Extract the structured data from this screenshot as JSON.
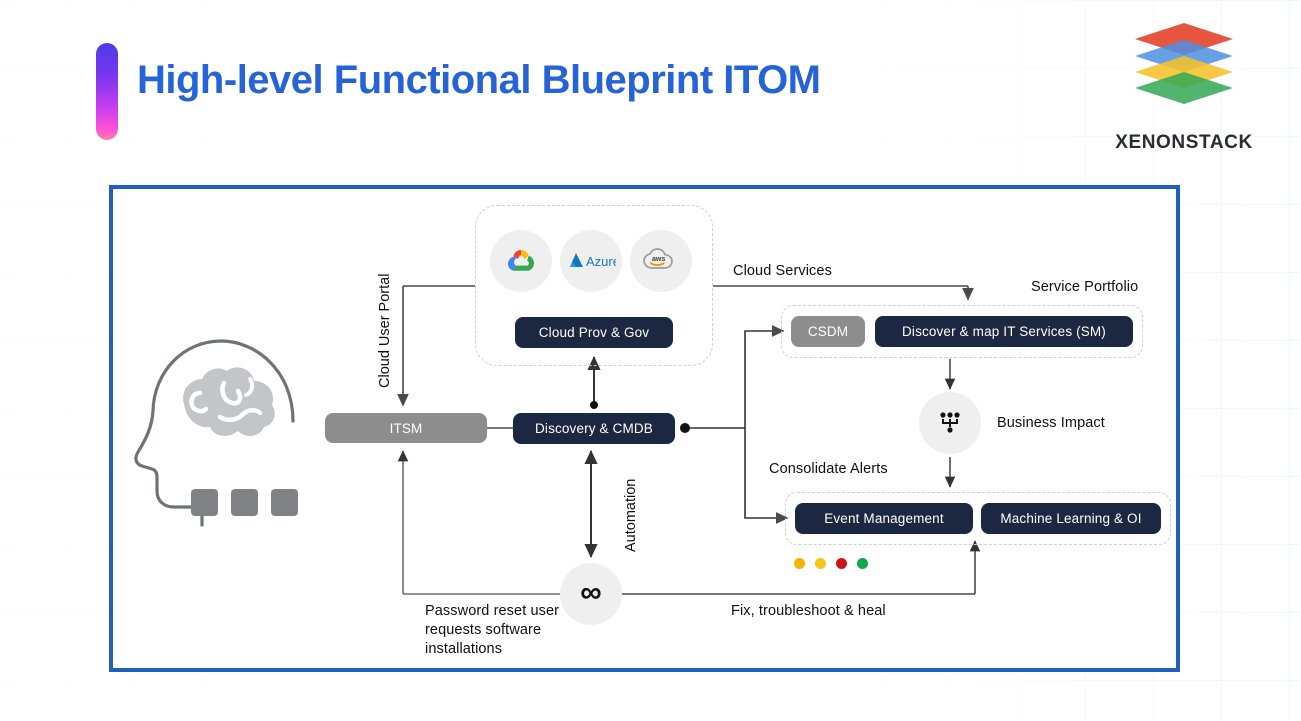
{
  "header": {
    "title": "High-level Functional Blueprint ITOM",
    "title_color": "#2563d6",
    "accent_bar": "gradient-violet-pink"
  },
  "brand": {
    "name": "XENONSTACK",
    "logo_name": "xenonstack-logo",
    "layer_colors": [
      "#e5482f",
      "#4a90e2",
      "#f6c12a",
      "#34a853"
    ]
  },
  "canvas": {
    "border_color": "#1f5fbe"
  },
  "persona": {
    "icon_name": "head-brain-icon",
    "blocks": 3
  },
  "cloud_group": {
    "providers": [
      {
        "name": "google-cloud-icon",
        "label": ""
      },
      {
        "name": "microsoft-azure-icon",
        "label": "Azure"
      },
      {
        "name": "aws-icon",
        "label": "aws"
      }
    ],
    "node_label": "Cloud Prov & Gov"
  },
  "nodes": {
    "itsm": "ITSM",
    "discovery_cmdb": "Discovery & CMDB",
    "csdm": "CSDM",
    "discover_map": "Discover & map IT Services (SM)",
    "event_management": "Event Management",
    "machine_learning": "Machine Learning & OI"
  },
  "labels": {
    "cloud_services": "Cloud Services",
    "service_portfolio": "Service Portfolio",
    "business_impact": "Business Impact",
    "consolidate_alerts": "Consolidate Alerts",
    "fix_troubleshoot": "Fix, troubleshoot & heal",
    "password_reset": "Password reset user requests software installations",
    "cloud_user_portal": "Cloud User Portal",
    "automation": "Automation"
  },
  "icons": {
    "business_impact": "hierarchy-icon",
    "automation": "infinity-icon",
    "infinity_glyph": "∞"
  },
  "status_dots": [
    {
      "name": "status-dot-amber",
      "color": "#f5b301"
    },
    {
      "name": "status-dot-yellow",
      "color": "#f5c518"
    },
    {
      "name": "status-dot-red",
      "color": "#cc1417"
    },
    {
      "name": "status-dot-green",
      "color": "#0fa84a"
    }
  ]
}
